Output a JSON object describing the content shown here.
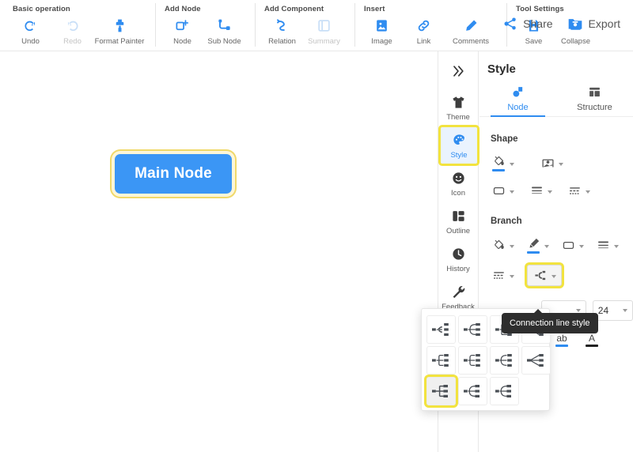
{
  "toolbar": {
    "groups": [
      {
        "title": "Basic operation",
        "items": [
          {
            "label": "Undo",
            "icon": "undo-icon",
            "disabled": false
          },
          {
            "label": "Redo",
            "icon": "redo-icon",
            "disabled": true
          },
          {
            "label": "Format Painter",
            "icon": "format-painter-icon",
            "disabled": false
          }
        ]
      },
      {
        "title": "Add Node",
        "items": [
          {
            "label": "Node",
            "icon": "add-node-icon",
            "disabled": false
          },
          {
            "label": "Sub Node",
            "icon": "add-sub-node-icon",
            "disabled": false
          }
        ]
      },
      {
        "title": "Add Component",
        "items": [
          {
            "label": "Relation",
            "icon": "relation-icon",
            "disabled": false
          },
          {
            "label": "Summary",
            "icon": "summary-icon",
            "disabled": true
          }
        ]
      },
      {
        "title": "Insert",
        "items": [
          {
            "label": "Image",
            "icon": "image-icon",
            "disabled": false
          },
          {
            "label": "Link",
            "icon": "link-icon",
            "disabled": false
          },
          {
            "label": "Comments",
            "icon": "comments-icon",
            "disabled": false
          }
        ]
      },
      {
        "title": "Tool Settings",
        "items": [
          {
            "label": "Save",
            "icon": "save-icon",
            "disabled": false
          },
          {
            "label": "Collapse",
            "icon": "collapse-icon",
            "disabled": false
          }
        ]
      }
    ],
    "right_actions": [
      {
        "label": "Share",
        "icon": "share-icon"
      },
      {
        "label": "Export",
        "icon": "export-folder-icon"
      }
    ]
  },
  "canvas": {
    "node": {
      "text": "Main Node",
      "fill_color": "#3b96f5",
      "selection_color": "#f0d96a"
    }
  },
  "rail": {
    "collapse_icon": "double-chevron-right-icon",
    "items": [
      {
        "label": "Theme",
        "icon": "tshirt-icon",
        "active": false
      },
      {
        "label": "Style",
        "icon": "palette-icon",
        "active": true
      },
      {
        "label": "Icon",
        "icon": "smiley-icon",
        "active": false
      },
      {
        "label": "Outline",
        "icon": "outline-layout-icon",
        "active": false
      },
      {
        "label": "History",
        "icon": "clock-icon",
        "active": false
      },
      {
        "label": "Feedback",
        "icon": "wrench-icon",
        "active": false
      }
    ],
    "highlight_color": "#f2e33f"
  },
  "panel": {
    "title": "Style",
    "tabs": [
      {
        "label": "Node",
        "icon": "node-shape-icon",
        "active": true
      },
      {
        "label": "Structure",
        "icon": "structure-icon",
        "active": false
      }
    ],
    "shape_section": {
      "title": "Shape",
      "row1": [
        {
          "name": "fill-color",
          "icon": "paint-bucket-icon",
          "underline": "#2f8cf0"
        },
        {
          "name": "border-image",
          "icon": "picture-frame-icon",
          "underline": ""
        }
      ],
      "row2": [
        {
          "name": "shape-type",
          "icon": "rounded-rect-icon"
        },
        {
          "name": "line-weight",
          "icon": "line-weight-icon"
        },
        {
          "name": "line-dash",
          "icon": "dashed-line-icon"
        }
      ]
    },
    "branch_section": {
      "title": "Branch",
      "row1": [
        {
          "name": "branch-fill-color",
          "icon": "paint-bucket-icon",
          "underline": ""
        },
        {
          "name": "branch-line-color",
          "icon": "pen-icon",
          "underline": "#2f8cf0"
        },
        {
          "name": "branch-shape",
          "icon": "rounded-rect-icon"
        },
        {
          "name": "branch-line-weight",
          "icon": "line-weight-icon"
        }
      ],
      "row2": [
        {
          "name": "branch-line-dash",
          "icon": "dashed-line-icon"
        },
        {
          "name": "connection-line-style",
          "icon": "connection-line-icon",
          "highlighted": true
        }
      ]
    },
    "font_size": {
      "empty_select_value": "",
      "size_value": "24"
    },
    "text_buttons": [
      {
        "label": "ab",
        "name": "text-highlight-color",
        "underline": "#2f8cf0"
      },
      {
        "label": "A",
        "name": "text-font-color",
        "underline": "#222222"
      }
    ]
  },
  "tooltip": {
    "text": "Connection line style"
  },
  "line_style_popup": {
    "selected_index": 8,
    "options": [
      {
        "icon": "line-style-curve-left"
      },
      {
        "icon": "line-style-arc-left"
      },
      {
        "icon": "line-style-bracket-left"
      },
      {
        "icon": "line-style-straight-left"
      },
      {
        "icon": "line-style-elbow-1"
      },
      {
        "icon": "line-style-elbow-2"
      },
      {
        "icon": "line-style-elbow-3"
      },
      {
        "icon": "line-style-fan"
      },
      {
        "icon": "line-style-tree"
      },
      {
        "icon": "line-style-curve-2"
      },
      {
        "icon": "line-style-curve-3"
      }
    ]
  }
}
